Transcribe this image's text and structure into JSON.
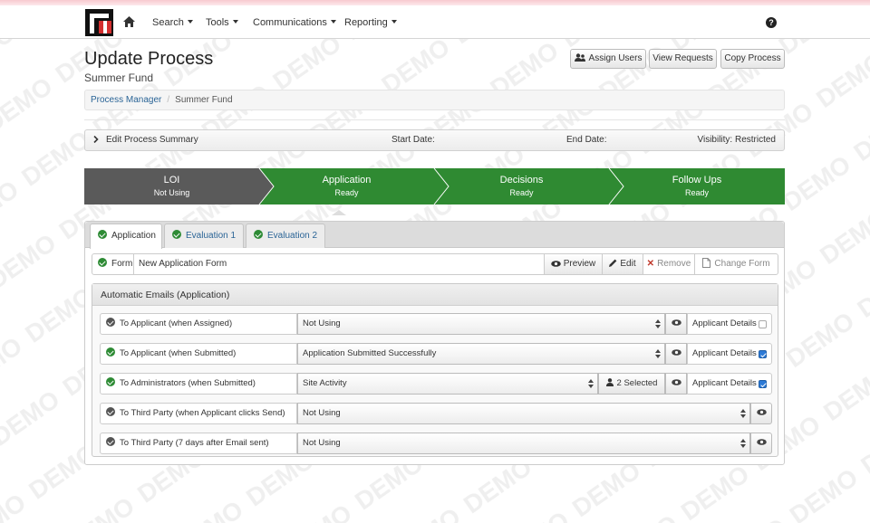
{
  "nav": {
    "search": "Search",
    "tools": "Tools",
    "communications": "Communications",
    "reporting": "Reporting"
  },
  "page": {
    "title": "Update Process",
    "subtitle": "Summer Fund"
  },
  "actions": {
    "assign_users": "Assign Users",
    "view_requests": "View Requests",
    "copy_process": "Copy Process"
  },
  "breadcrumb": {
    "root": "Process Manager",
    "current": "Summer Fund"
  },
  "summary": {
    "edit_label": "Edit Process Summary",
    "start_date": "Start Date:",
    "end_date": "End Date:",
    "visibility": "Visibility: Restricted"
  },
  "steps": [
    {
      "label": "LOI",
      "status": "Not Using"
    },
    {
      "label": "Application",
      "status": "Ready"
    },
    {
      "label": "Decisions",
      "status": "Ready"
    },
    {
      "label": "Follow Ups",
      "status": "Ready"
    }
  ],
  "tabs": [
    "Application",
    "Evaluation 1",
    "Evaluation 2"
  ],
  "form": {
    "label": "Form",
    "name": "New Application Form",
    "preview": "Preview",
    "edit": "Edit",
    "remove": "Remove",
    "change": "Change Form"
  },
  "emails": {
    "heading": "Automatic Emails (Application)",
    "rows": [
      {
        "label": "To Applicant (when Assigned)",
        "template": "Not Using",
        "details": "Applicant Details",
        "details_checked": false,
        "status": "inactive"
      },
      {
        "label": "To Applicant (when Submitted)",
        "template": "Application Submitted Successfully",
        "details": "Applicant Details",
        "details_checked": true,
        "status": "active"
      },
      {
        "label": "To Administrators (when Submitted)",
        "template": "Site Activity",
        "recipients": "2 Selected",
        "details": "Applicant Details",
        "details_checked": true,
        "status": "active"
      },
      {
        "label": "To Third Party (when Applicant clicks Send)",
        "template": "Not Using",
        "status": "inactive"
      },
      {
        "label": "To Third Party (7 days after Email sent)",
        "template": "Not Using",
        "status": "inactive"
      }
    ]
  },
  "watermark": "DEMO",
  "colors": {
    "step_grey": "#5a5a5a",
    "step_green": "#2f8a32",
    "check_green": "#2e8b35",
    "link_blue": "#2a6496",
    "remove_red": "#c0392b"
  }
}
